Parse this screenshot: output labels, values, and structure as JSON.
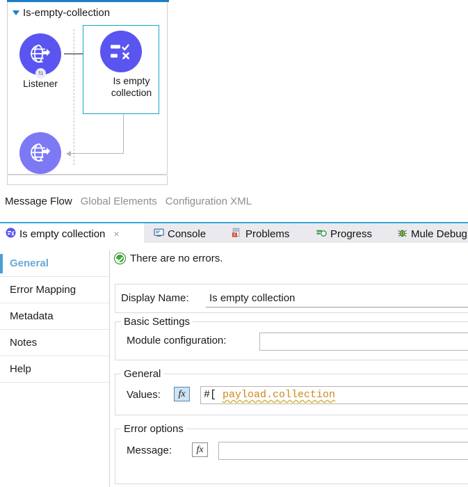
{
  "flow": {
    "name": "Is-empty-collection",
    "collapse_icon": "triangle-down-icon",
    "nodes": [
      {
        "id": "listener",
        "label": "Listener",
        "icon": "globe-arrow-icon",
        "badge_icon": "exchange-arrows-icon",
        "state": "normal"
      },
      {
        "id": "is-empty-collection",
        "label": "Is empty\ncollection",
        "label_line1": "Is empty",
        "label_line2": "collection",
        "icon": "list-check-x-icon",
        "state": "selected"
      },
      {
        "id": "listener-response",
        "label": "",
        "icon": "globe-arrow-icon",
        "state": "faded"
      }
    ],
    "selection_color": "#16a5c4",
    "node_color": "#5a55f0",
    "node_color_faded": "#7d79f5"
  },
  "view_tabs": [
    {
      "label": "Message Flow",
      "active": true
    },
    {
      "label": "Global Elements",
      "active": false
    },
    {
      "label": "Configuration XML",
      "active": false
    }
  ],
  "panel_tabs": [
    {
      "label": "Is empty collection",
      "icon": "mule-component-icon",
      "active": true,
      "closable": true,
      "close_label": "×"
    },
    {
      "label": "Console",
      "icon": "console-icon",
      "active": false
    },
    {
      "label": "Problems",
      "icon": "problems-icon",
      "active": false
    },
    {
      "label": "Progress",
      "icon": "progress-icon",
      "active": false
    },
    {
      "label": "Mule Debug",
      "icon": "bug-icon",
      "active": false
    }
  ],
  "sidebar": {
    "items": [
      {
        "label": "General",
        "active": true
      },
      {
        "label": "Error Mapping",
        "active": false
      },
      {
        "label": "Metadata",
        "active": false
      },
      {
        "label": "Notes",
        "active": false
      },
      {
        "label": "Help",
        "active": false
      }
    ],
    "active_color": "#6aa9d8"
  },
  "form": {
    "status": {
      "text": "There are no errors.",
      "icon": "ok-check-icon",
      "color": "#3faa35"
    },
    "display_name": {
      "label": "Display Name:",
      "value": "Is empty collection"
    },
    "basic_settings": {
      "legend": "Basic Settings",
      "module_configuration": {
        "label": "Module configuration:",
        "value": "",
        "placeholder": ""
      }
    },
    "general": {
      "legend": "General",
      "values": {
        "label": "Values:",
        "fx_label": "fx",
        "fx_active": true,
        "value_prefix": "#[ ",
        "value_expression": "payload.collection"
      }
    },
    "error_options": {
      "legend": "Error options",
      "message": {
        "label": "Message:",
        "fx_label": "fx",
        "fx_active": false,
        "value": "",
        "placeholder": ""
      }
    }
  }
}
